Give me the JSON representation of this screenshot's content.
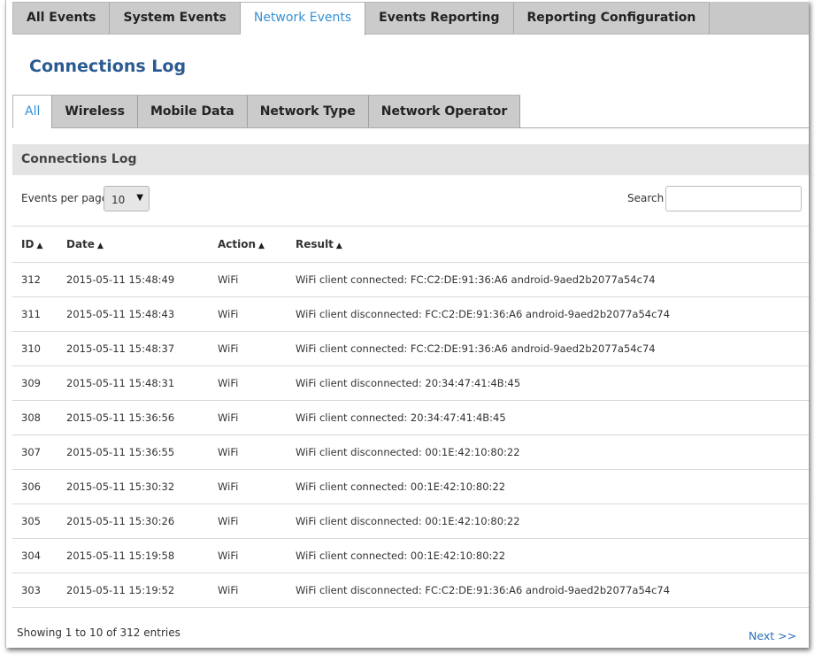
{
  "top_tabs": [
    {
      "label": "All Events"
    },
    {
      "label": "System Events"
    },
    {
      "label": "Network Events"
    },
    {
      "label": "Events Reporting"
    },
    {
      "label": "Reporting Configuration"
    }
  ],
  "page_title": "Connections Log",
  "sub_tabs": [
    {
      "label": "All"
    },
    {
      "label": "Wireless"
    },
    {
      "label": "Mobile Data"
    },
    {
      "label": "Network Type"
    },
    {
      "label": "Network Operator"
    }
  ],
  "section_title": "Connections Log",
  "controls": {
    "per_page_label": "Events per page",
    "per_page_value": "10",
    "search_label": "Search",
    "search_value": ""
  },
  "table": {
    "columns": [
      "ID",
      "Date",
      "Action",
      "Result"
    ],
    "rows": [
      [
        "312",
        "2015-05-11 15:48:49",
        "WiFi",
        "WiFi client connected: FC:C2:DE:91:36:A6 android-9aed2b2077a54c74"
      ],
      [
        "311",
        "2015-05-11 15:48:43",
        "WiFi",
        "WiFi client disconnected: FC:C2:DE:91:36:A6 android-9aed2b2077a54c74"
      ],
      [
        "310",
        "2015-05-11 15:48:37",
        "WiFi",
        "WiFi client connected: FC:C2:DE:91:36:A6 android-9aed2b2077a54c74"
      ],
      [
        "309",
        "2015-05-11 15:48:31",
        "WiFi",
        "WiFi client disconnected: 20:34:47:41:4B:45"
      ],
      [
        "308",
        "2015-05-11 15:36:56",
        "WiFi",
        "WiFi client connected: 20:34:47:41:4B:45"
      ],
      [
        "307",
        "2015-05-11 15:36:55",
        "WiFi",
        "WiFi client disconnected: 00:1E:42:10:80:22"
      ],
      [
        "306",
        "2015-05-11 15:30:32",
        "WiFi",
        "WiFi client connected: 00:1E:42:10:80:22"
      ],
      [
        "305",
        "2015-05-11 15:30:26",
        "WiFi",
        "WiFi client disconnected: 00:1E:42:10:80:22"
      ],
      [
        "304",
        "2015-05-11 15:19:58",
        "WiFi",
        "WiFi client connected: 00:1E:42:10:80:22"
      ],
      [
        "303",
        "2015-05-11 15:19:52",
        "WiFi",
        "WiFi client disconnected: FC:C2:DE:91:36:A6 android-9aed2b2077a54c74"
      ]
    ]
  },
  "footer": {
    "info": "Showing 1 to 10 of 312 entries",
    "next_label": "Next >>"
  },
  "icons": {
    "sort": "sort-up-icon",
    "dropdown": "dropdown-arrow-icon"
  },
  "colors": {
    "accent": "#3591d6",
    "title": "#2a5a92",
    "tab_bg": "#cbcbcb",
    "header_bg": "#e4e4e4"
  }
}
